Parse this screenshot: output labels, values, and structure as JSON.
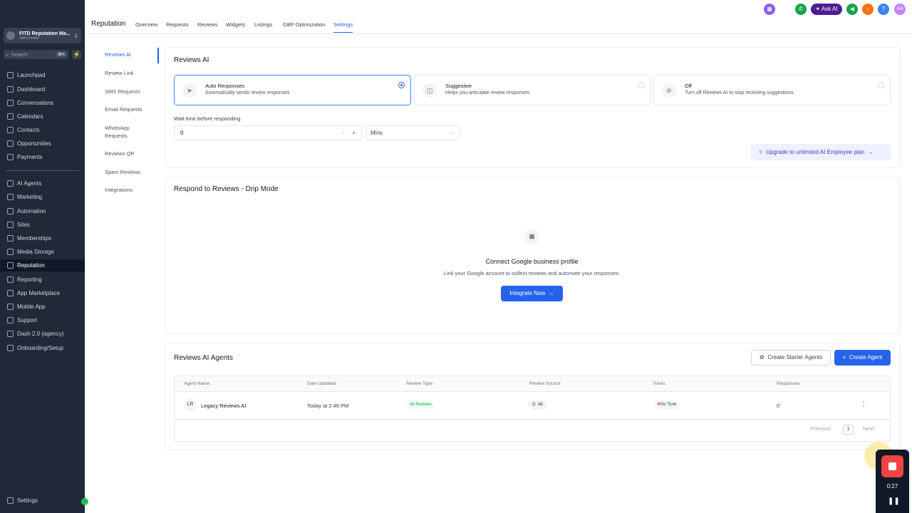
{
  "sidebar": {
    "account_name": "FITD Reputation Ma...",
    "account_location": "Vancouver",
    "search_placeholder": "Search",
    "search_shortcut": "⌘K",
    "items": [
      {
        "label": "Launchpad",
        "icon": "rocket-icon"
      },
      {
        "label": "Dashboard",
        "icon": "dashboard-icon"
      },
      {
        "label": "Conversations",
        "icon": "chat-icon"
      },
      {
        "label": "Calendars",
        "icon": "calendar-icon"
      },
      {
        "label": "Contacts",
        "icon": "contacts-icon"
      },
      {
        "label": "Opportunities",
        "icon": "funnel-icon"
      },
      {
        "label": "Payments",
        "icon": "payments-icon"
      },
      {
        "label": "AI Agents",
        "icon": "sparkle-icon"
      },
      {
        "label": "Marketing",
        "icon": "send-icon"
      },
      {
        "label": "Automation",
        "icon": "automation-icon"
      },
      {
        "label": "Sites",
        "icon": "globe-icon"
      },
      {
        "label": "Memberships",
        "icon": "membership-icon"
      },
      {
        "label": "Media Storage",
        "icon": "image-icon"
      },
      {
        "label": "Reputation",
        "icon": "star-icon"
      },
      {
        "label": "Reporting",
        "icon": "chart-icon"
      },
      {
        "label": "App Marketplace",
        "icon": "grid-icon"
      },
      {
        "label": "Mobile App",
        "icon": "phone-icon"
      },
      {
        "label": "Support",
        "icon": "wrench-icon"
      },
      {
        "label": "Dash 2.0 (agency)",
        "icon": "youtube-icon"
      },
      {
        "label": "Onboarding/Setup",
        "icon": "wrench-icon"
      }
    ],
    "settings_label": "Settings"
  },
  "header": {
    "title": "Reputation",
    "tabs": [
      "Overview",
      "Requests",
      "Reviews",
      "Widgets",
      "Listings",
      "GBP Optimization",
      "Settings"
    ],
    "ask_ai_label": "Ask AI",
    "user_initials": "AA"
  },
  "subnav": {
    "items": [
      "Reviews AI",
      "Review Link",
      "SMS Requests",
      "Email Requests",
      "WhatsApp Requests",
      "Reviews QR",
      "Spam Reviews",
      "Integrations"
    ]
  },
  "reviews_ai": {
    "title": "Reviews AI",
    "options": [
      {
        "title": "Auto Responses",
        "desc": "Automatically sends review responses",
        "selected": true
      },
      {
        "title": "Suggestive",
        "desc": "Helps you articulate review responses",
        "selected": false
      },
      {
        "title": "Off",
        "desc": "Turn off Reviews AI to stop receiving suggestions.",
        "selected": false
      }
    ],
    "wait_label": "Wait time before responding",
    "wait_value": "0",
    "unit_value": "Mins",
    "upgrade_label": "Upgrade to unlimited AI Employee plan"
  },
  "drip": {
    "title": "Respond to Reviews - Drip Mode",
    "empty_title": "Connect Google business profile",
    "empty_desc": "Link your Google account to collect reviews and automate your responses.",
    "integrate_label": "Integrate Now"
  },
  "agents": {
    "title": "Reviews AI Agents",
    "starter_label": "Create Starter Agents",
    "create_label": "Create Agent",
    "columns": [
      "Agent Name",
      "Date Updated",
      "Review Type",
      "Review Source",
      "Tones",
      "Responses"
    ],
    "rows": [
      {
        "initials": "LR",
        "name": "Legacy Reviews AI",
        "date": "Today at 2:46 PM",
        "type": "All Reviews",
        "source": "All",
        "tone": "No Tone",
        "responses": "0"
      }
    ],
    "pager": {
      "previous": "Previous",
      "page": "1",
      "next": "Next"
    }
  },
  "recorder": {
    "time": "0:27"
  },
  "colors": {
    "sidebar_bg": "#1f2937",
    "accent": "#2563eb",
    "ask_ai_bg": "#4c1d95",
    "record": "#ef4444"
  }
}
